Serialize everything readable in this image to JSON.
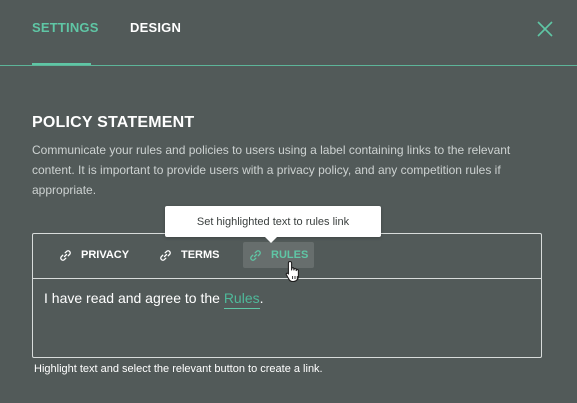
{
  "header": {
    "tabs": [
      {
        "label": "SETTINGS",
        "active": true
      },
      {
        "label": "DESIGN",
        "active": false
      }
    ],
    "close_icon": "close-icon"
  },
  "section": {
    "title": "POLICY STATEMENT",
    "description": "Communicate your rules and policies to users using a label containing links to the relevant content. It is important to provide users with a privacy policy, and any competition rules if appropriate."
  },
  "tooltip": {
    "text": "Set highlighted text to rules link"
  },
  "editor": {
    "toolbar": [
      {
        "label": "PRIVACY",
        "icon": "link-icon",
        "selected": false
      },
      {
        "label": "TERMS",
        "icon": "link-icon",
        "selected": false
      },
      {
        "label": "RULES",
        "icon": "link-icon",
        "selected": true
      }
    ],
    "content_prefix": "I have read and agree to the ",
    "content_link": "Rules",
    "content_suffix": "."
  },
  "helper_text": "Highlight text and select the relevant button to create a link.",
  "colors": {
    "background": "#525a59",
    "accent": "#5fc6a5",
    "link": "#4fb99a",
    "border": "#d8dcdb"
  }
}
